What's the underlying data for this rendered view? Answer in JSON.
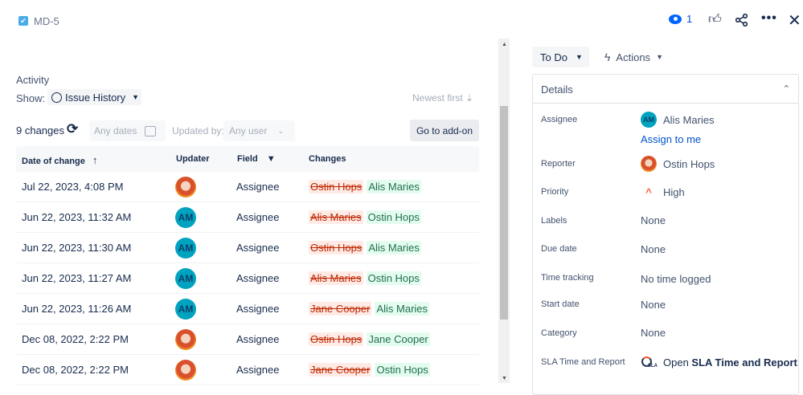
{
  "header": {
    "issue_key": "MD-5",
    "watchers": "1"
  },
  "activity": {
    "title": "Activity",
    "show_label": "Show:",
    "show_value": "Issue History",
    "sort": "Newest first",
    "changes_count": "9 changes",
    "dates_placeholder": "Any dates",
    "updated_by_label": "Updated by:",
    "user_placeholder": "Any user",
    "go_button": "Go to add-on"
  },
  "table": {
    "headers": [
      "Date of change",
      "Updater",
      "Field",
      "Changes"
    ],
    "rows": [
      {
        "date": "Jul 22, 2023, 4:08 PM",
        "updater": "photo",
        "field": "Assignee",
        "old": "Ostin Hops",
        "new": "Alis Maries"
      },
      {
        "date": "Jun 22, 2023, 11:32 AM",
        "updater": "AM",
        "field": "Assignee",
        "old": "Alis Maries",
        "new": "Ostin Hops"
      },
      {
        "date": "Jun 22, 2023, 11:30 AM",
        "updater": "AM",
        "field": "Assignee",
        "old": "Ostin Hops",
        "new": "Alis Maries"
      },
      {
        "date": "Jun 22, 2023, 11:27 AM",
        "updater": "AM",
        "field": "Assignee",
        "old": "Alis Maries",
        "new": "Ostin Hops"
      },
      {
        "date": "Jun 22, 2023, 11:26 AM",
        "updater": "AM",
        "field": "Assignee",
        "old": "Jane Cooper",
        "new": "Alis Maries"
      },
      {
        "date": "Dec 08, 2022, 2:22 PM",
        "updater": "photo",
        "field": "Assignee",
        "old": "Ostin Hops",
        "new": "Jane Cooper"
      },
      {
        "date": "Dec 08, 2022, 2:22 PM",
        "updater": "photo",
        "field": "Assignee",
        "old": "Jane Cooper",
        "new": "Ostin Hops"
      }
    ]
  },
  "side": {
    "status": "To Do",
    "actions": "Actions",
    "details_title": "Details",
    "assignee_label": "Assignee",
    "assignee": "Alis Maries",
    "assignee_initials": "AM",
    "assign_to_me": "Assign to me",
    "reporter_label": "Reporter",
    "reporter": "Ostin Hops",
    "priority_label": "Priority",
    "priority": "High",
    "labels_label": "Labels",
    "labels": "None",
    "due_label": "Due date",
    "due": "None",
    "time_label": "Time tracking",
    "time": "No time logged",
    "start_label": "Start date",
    "start": "None",
    "category_label": "Category",
    "category": "None",
    "sla_label": "SLA Time and Report",
    "sla_prefix": "Open ",
    "sla_link": "SLA Time and Report",
    "sla_icon_text": "SLA"
  }
}
